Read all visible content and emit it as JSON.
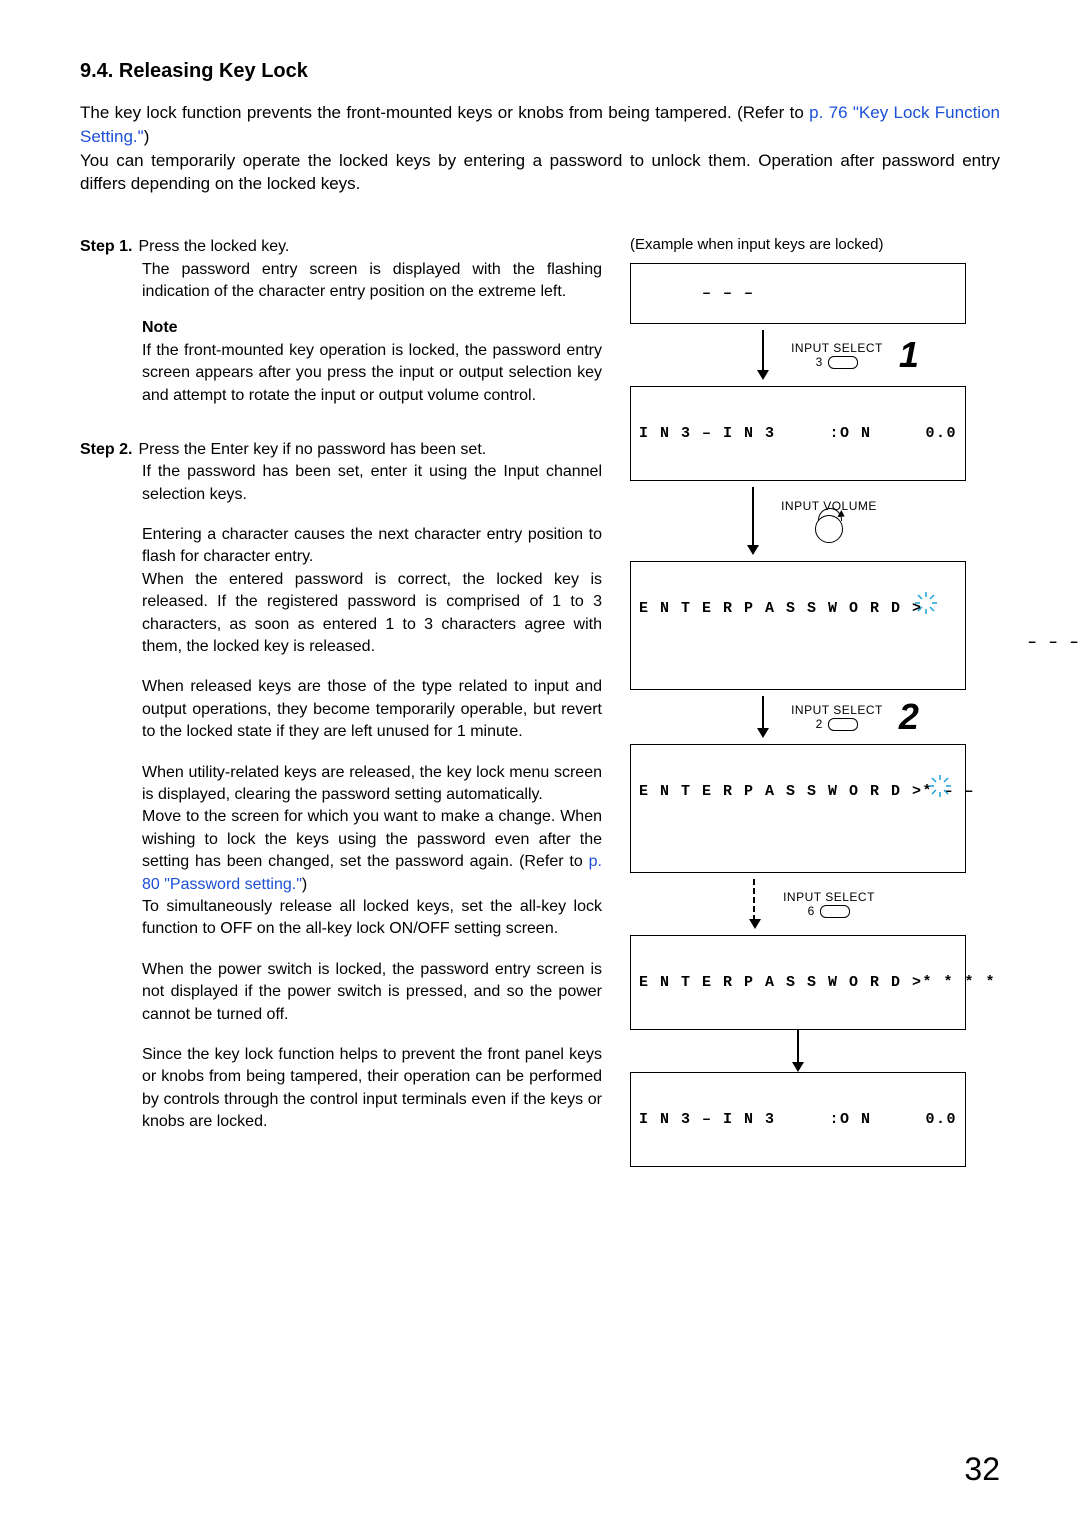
{
  "section": {
    "number": "9.4.",
    "title": "Releasing Key Lock"
  },
  "intro": {
    "p1a": "The key lock function prevents the front-mounted keys or knobs from being tampered. (Refer to ",
    "link1": "p. 76 \"Key Lock Function Setting.\"",
    "p1b": ")",
    "p2": "You can temporarily operate the locked keys by entering a password to unlock them. Operation after password entry differs depending on the locked keys."
  },
  "steps": {
    "s1": {
      "label": "Step 1.",
      "first": "Press the locked key.",
      "body1": "The password entry screen is displayed with the flashing indication of the character entry position on the extreme left.",
      "note_label": "Note",
      "note": "If the front-mounted key operation is locked, the password entry screen appears after you press the input or output selection key and attempt to rotate the input or output volume control."
    },
    "s2": {
      "label": "Step 2.",
      "first": "Press the Enter key if no password has been set.",
      "line2": "If the password has been set, enter it using the Input channel selection keys.",
      "p3": "Entering a character causes the next character entry position to flash for character entry.",
      "p4": "When the entered password is correct, the locked key is released. If the registered password is comprised of 1 to 3 characters, as soon as entered 1 to 3 characters agree with them, the locked key is released.",
      "p5": "When released keys are those of the type related to input and output operations, they become temporarily operable, but revert to the locked state if they are left unused for 1 minute.",
      "p6": "When utility-related keys are released, the key lock menu screen is displayed, clearing the password setting automatically.",
      "p7a": "Move to the screen for which you want to make a change. When wishing to lock the keys using the password even after the setting has been changed, set the password again. (Refer to ",
      "link2": "p. 80 \"Password setting.\"",
      "p7b": ")",
      "p8": "To simultaneously release all locked keys, set the all-key lock function to OFF on the all-key lock ON/OFF setting screen.",
      "p9": "When the power switch is locked, the password entry screen is not displayed if the power switch is pressed, and so the power cannot be turned off.",
      "p10": "Since the key lock function helps to prevent the front panel keys or knobs from being tampered, their operation can be performed by controls through the control input terminals even if the keys or knobs are locked."
    }
  },
  "right": {
    "example_label": "(Example when input keys are locked)",
    "lcd0": "– – –",
    "a1_label": "INPUT SELECT",
    "a1_key": "3",
    "step1_num": "1",
    "lcd1_l": "I N 3 – I N 3",
    "lcd1_m": ":O N",
    "lcd1_r": "0.0",
    "a2_label": "INPUT VOLUME",
    "lcd2_l": "E N T E R P A S S W O R D >",
    "lcd2_r": "– – –",
    "a3_label": "INPUT SELECT",
    "a3_key": "2",
    "step2_num": "2",
    "lcd3_l": "E N T E R P A S S W O R D >",
    "lcd3_r": "* – –",
    "a4_label": "INPUT SELECT",
    "a4_key": "6",
    "lcd4_l": "E N T E R P A S S W O R D >",
    "lcd4_r": "* * * *",
    "lcd5_l": "I N 3 – I N 3",
    "lcd5_m": ":O N",
    "lcd5_r": "0.0"
  },
  "page_number": "32"
}
